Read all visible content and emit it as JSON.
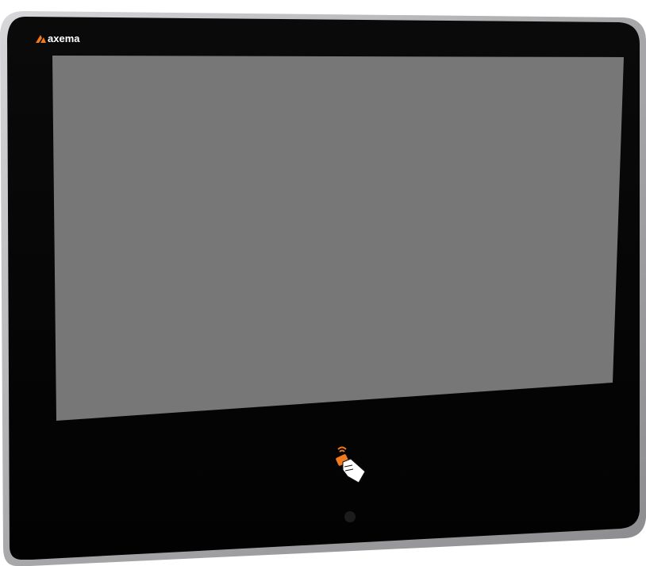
{
  "device": {
    "brand_name": "axema",
    "colors": {
      "frame": "#b9b9bb",
      "bezel": "#050505",
      "screen": "#777777",
      "brand_accent": "#f07a1e",
      "camera": "#1c1c1c"
    },
    "icons": {
      "logo": "axema-logo-icon",
      "reader": "contactless-card-reader-icon",
      "camera": "camera-lens-icon"
    }
  }
}
